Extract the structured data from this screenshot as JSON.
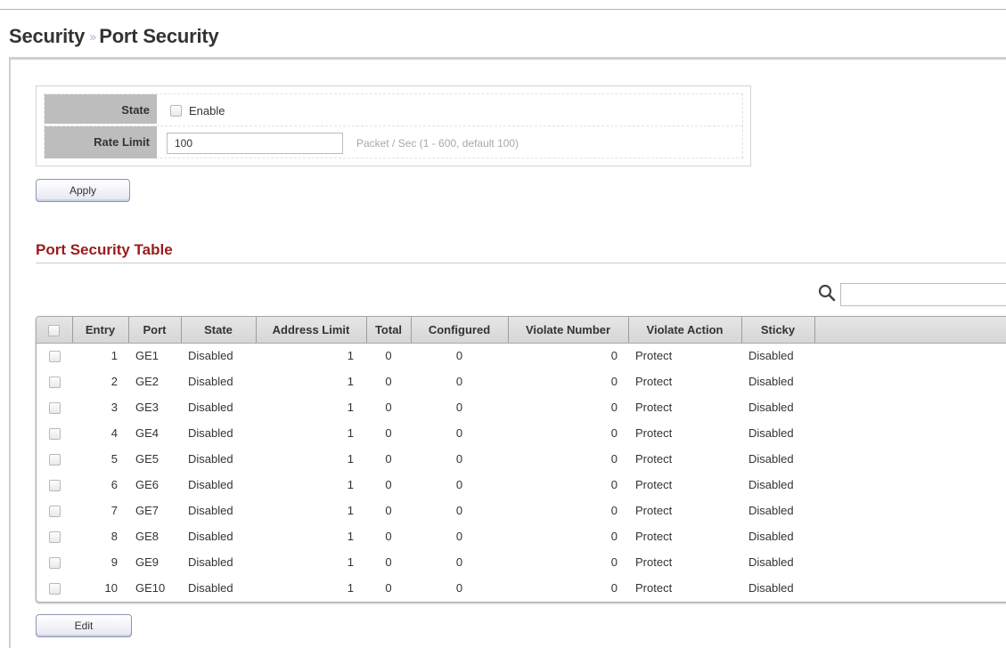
{
  "breadcrumb": {
    "parent": "Security",
    "separator": "››",
    "current": "Port Security"
  },
  "form": {
    "state_label": "State",
    "enable_label": "Enable",
    "rate_limit_label": "Rate Limit",
    "rate_limit_value": "100",
    "rate_limit_hint": "Packet / Sec  (1 - 600, default 100)"
  },
  "buttons": {
    "apply": "Apply",
    "edit": "Edit"
  },
  "table": {
    "title": "Port Security Table",
    "columns": [
      "Entry",
      "Port",
      "State",
      "Address Limit",
      "Total",
      "Configured",
      "Violate Number",
      "Violate Action",
      "Sticky"
    ],
    "rows": [
      {
        "entry": "1",
        "port": "GE1",
        "state": "Disabled",
        "address_limit": "1",
        "total": "0",
        "configured": "0",
        "violate_number": "0",
        "violate_action": "Protect",
        "sticky": "Disabled"
      },
      {
        "entry": "2",
        "port": "GE2",
        "state": "Disabled",
        "address_limit": "1",
        "total": "0",
        "configured": "0",
        "violate_number": "0",
        "violate_action": "Protect",
        "sticky": "Disabled"
      },
      {
        "entry": "3",
        "port": "GE3",
        "state": "Disabled",
        "address_limit": "1",
        "total": "0",
        "configured": "0",
        "violate_number": "0",
        "violate_action": "Protect",
        "sticky": "Disabled"
      },
      {
        "entry": "4",
        "port": "GE4",
        "state": "Disabled",
        "address_limit": "1",
        "total": "0",
        "configured": "0",
        "violate_number": "0",
        "violate_action": "Protect",
        "sticky": "Disabled"
      },
      {
        "entry": "5",
        "port": "GE5",
        "state": "Disabled",
        "address_limit": "1",
        "total": "0",
        "configured": "0",
        "violate_number": "0",
        "violate_action": "Protect",
        "sticky": "Disabled"
      },
      {
        "entry": "6",
        "port": "GE6",
        "state": "Disabled",
        "address_limit": "1",
        "total": "0",
        "configured": "0",
        "violate_number": "0",
        "violate_action": "Protect",
        "sticky": "Disabled"
      },
      {
        "entry": "7",
        "port": "GE7",
        "state": "Disabled",
        "address_limit": "1",
        "total": "0",
        "configured": "0",
        "violate_number": "0",
        "violate_action": "Protect",
        "sticky": "Disabled"
      },
      {
        "entry": "8",
        "port": "GE8",
        "state": "Disabled",
        "address_limit": "1",
        "total": "0",
        "configured": "0",
        "violate_number": "0",
        "violate_action": "Protect",
        "sticky": "Disabled"
      },
      {
        "entry": "9",
        "port": "GE9",
        "state": "Disabled",
        "address_limit": "1",
        "total": "0",
        "configured": "0",
        "violate_number": "0",
        "violate_action": "Protect",
        "sticky": "Disabled"
      },
      {
        "entry": "10",
        "port": "GE10",
        "state": "Disabled",
        "address_limit": "1",
        "total": "0",
        "configured": "0",
        "violate_number": "0",
        "violate_action": "Protect",
        "sticky": "Disabled"
      }
    ]
  },
  "colors": {
    "section_title": "#9a1b1b",
    "label_bg": "#bdbdbd",
    "header_bg": "#dcdcdc",
    "separator": "#aab8d8"
  },
  "icons": {
    "search": "search-icon",
    "checkbox": "checkbox-icon"
  }
}
